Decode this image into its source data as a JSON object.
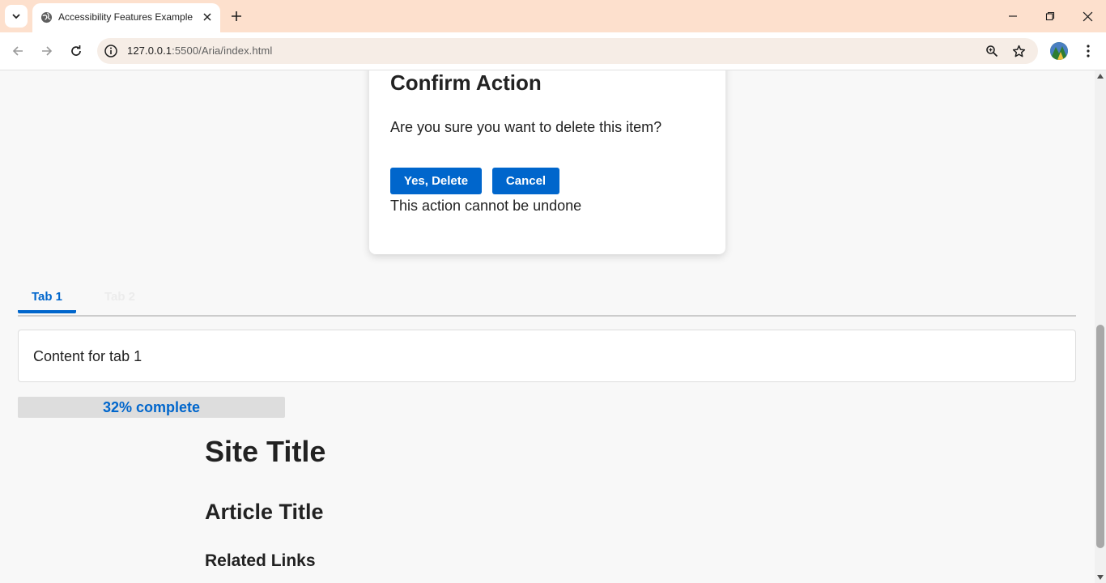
{
  "browser": {
    "tab_title": "Accessibility Features Example",
    "url_host": "127.0.0.1",
    "url_rest": ":5500/Aria/index.html"
  },
  "icons": {
    "tab_menu": "chevron-down-icon",
    "tab_favicon": "globe-icon",
    "tab_close": "close-icon",
    "new_tab": "plus-icon",
    "back": "arrow-left-icon",
    "forward": "arrow-right-icon",
    "reload": "reload-icon",
    "site_info": "info-icon",
    "zoom": "zoom-icon",
    "bookmark": "star-icon",
    "menu": "kebab-menu-icon"
  },
  "dialog": {
    "title": "Confirm Action",
    "message": "Are you sure you want to delete this item?",
    "confirm_label": "Yes, Delete",
    "cancel_label": "Cancel",
    "note": "This action cannot be undone"
  },
  "tabs": {
    "items": [
      {
        "label": "Tab 1",
        "selected": true
      },
      {
        "label": "Tab 2",
        "selected": false
      }
    ],
    "panel_text": "Content for tab 1"
  },
  "progress": {
    "value": 32,
    "label": "32% complete"
  },
  "content": {
    "site_title": "Site Title",
    "article_title": "Article Title",
    "related_links": "Related Links"
  },
  "colors": {
    "accent": "#0066cc",
    "tabstrip": "#fde0cd",
    "page_bg": "#f8f8f8"
  }
}
